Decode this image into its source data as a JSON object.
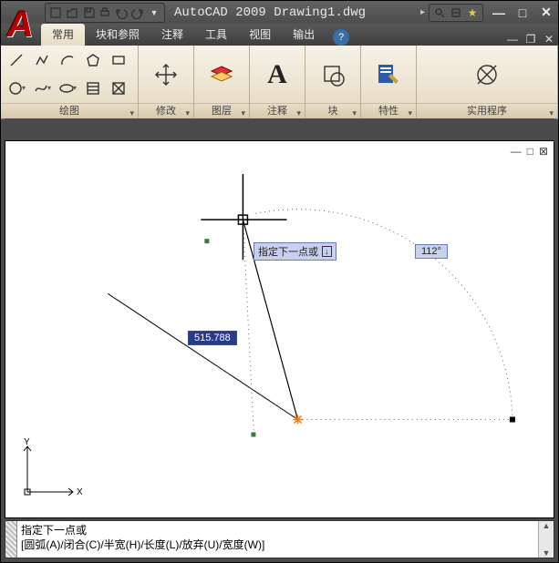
{
  "title": "AutoCAD 2009 Drawing1.dwg",
  "qat_icons": [
    "new",
    "open",
    "save",
    "print",
    "undo",
    "redo"
  ],
  "tabs": [
    "常用",
    "块和参照",
    "注释",
    "工具",
    "视图",
    "输出"
  ],
  "active_tab_index": 0,
  "ribbon": {
    "draw_label": "绘图",
    "modify_label": "修改",
    "layers_label": "图层",
    "annot_label": "注释",
    "block_label": "块",
    "props_label": "特性",
    "util_label": "实用程序"
  },
  "drawing": {
    "prompt": "指定下一点或",
    "length_value": "515.788",
    "angle_value": "112°",
    "ucs_x": "X",
    "ucs_y": "Y"
  },
  "command": {
    "line1": "指定下一点或",
    "line2": "[圆弧(A)/闭合(C)/半宽(H)/长度(L)/放弃(U)/宽度(W)]"
  }
}
